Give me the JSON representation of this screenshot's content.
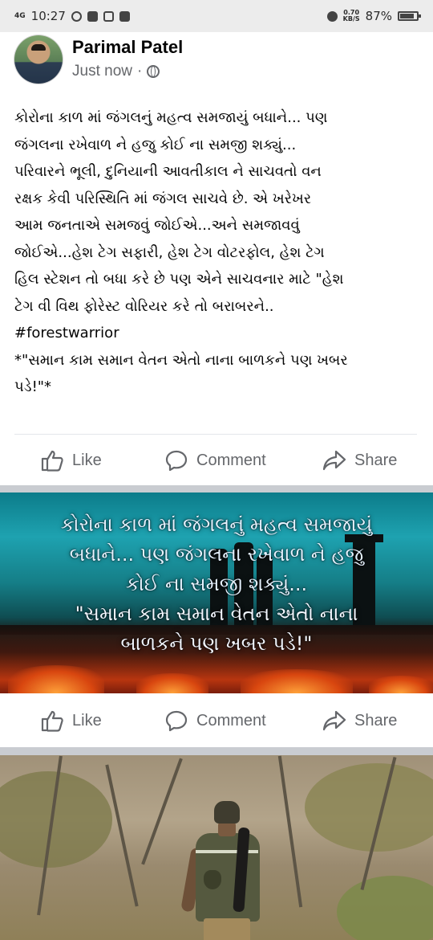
{
  "status_bar": {
    "signal": "4G",
    "time": "10:27",
    "data_speed": "0.70",
    "data_unit": "KB/S",
    "battery": "87%"
  },
  "post": {
    "author_name": "Parimal Patel",
    "timestamp": "Just now",
    "separator": "·",
    "text": "કોરોના કાળ માં જંગલનું મહત્વ સમજાયું બધાને... પણ\nજંગલના રખેવાળ ને હજુ કોઈ ના સમજી શક્યું...\nપરિવારને ભૂલી, દુનિયાની આવતીકાલ ને સાચવતો વન\nરક્ષક કેવી પરિસ્થિતિ માં જંગલ સાચવે છે. એ ખરેખર\nઆમ જનતાએ સમજવું જોઈએ...અને સમજાવવું\nજોઈએ...હેશ ટેગ સફારી, હેશ ટેગ વોટરફોલ, હેશ ટેગ\nહિલ સ્ટેશન તો બધા કરે છે પણ એને સાચવનાર માટે \"હેશ\nટેગ વી વિથ ફોરેસ્ટ વોરિયર કરે તો બરાબરને..\n#forestwarrior\n*\"સમાન કામ સમાન વેતન એતો નાના બાળકને પણ ખબર\nપડે!\"*"
  },
  "actions": {
    "like": "Like",
    "comment": "Comment",
    "share": "Share"
  },
  "image_post": {
    "caption_line1": "કોરોના કાળ માં જંગલનું મહત્વ સમજાયું",
    "caption_line2": "બધાને... પણ જંગલના રખેવાળ ને હજુ",
    "caption_line3": "કોઈ ના સમજી શક્યું...",
    "caption_line4": "\"સમાન કામ સમાન વેતન એતો નાના",
    "caption_line5": "બાળકને પણ ખબર પડે!\""
  },
  "colors": {
    "text_primary": "#050505",
    "text_secondary": "#65676b",
    "separator": "#c9ccd1"
  }
}
